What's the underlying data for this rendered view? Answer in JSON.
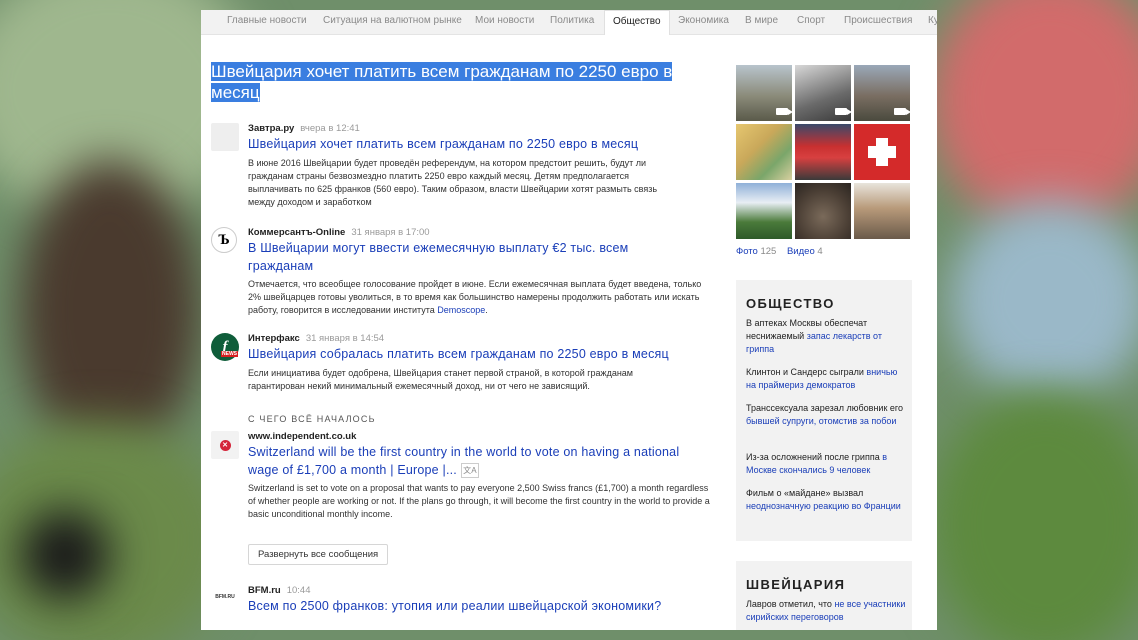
{
  "nav": {
    "items": [
      "Главные новости",
      "Ситуация на валютном рынке",
      "Мои новости",
      "Политика",
      "Общество",
      "Экономика",
      "В мире",
      "Спорт",
      "Происшествия",
      "Ку"
    ],
    "active": "Общество"
  },
  "headline": "Швейцария хочет платить всем гражданам по 2250 евро в месяц",
  "articles": [
    {
      "source": "Завтра.ру",
      "time": "вчера в 12:41",
      "title": "Швейцария хочет платить всем гражданам по 2250 евро в месяц",
      "snippet": "В июне 2016 Швейцарии будет проведён референдум, на котором предстоит решить, будут ли гражданам страны безвозмездно платить 2250 евро каждый месяц. Детям предполагается выплачивать по 625 франков (560 евро). Таким образом, власти Швейцарии хотят размыть связь между доходом и заработком"
    },
    {
      "source": "Коммерсантъ-Online",
      "time": "31 января в 17:00",
      "title": "В Швейцарии могут ввести ежемесячную выплату €2 тыс. всем гражданам",
      "snippet": "Отмечается, что всеобщее голосование пройдет в июне. Если ежемесячная выплата будет введена, только 2% швейцарцев готовы уволиться, в то время как большинство намерены продолжить работать или искать работу, говорится в исследовании института",
      "snippet_link": "Demoscope",
      "snippet_end": "."
    },
    {
      "source": "Интерфакс",
      "time": "31 января в 14:54",
      "title": "Швейцария собралась платить всем гражданам по 2250 евро в месяц",
      "snippet": "Если инициатива будет одобрена, Швейцария станет первой страной, в которой гражданам гарантирован некий минимальный ежемесячный доход, ни от чего не зависящий."
    },
    {
      "source": "www.independent.co.uk",
      "time": "",
      "title": "Switzerland will be the first country in the world to vote on having a national wage of £1,700 a month | Europe |...",
      "snippet": "Switzerland is set to vote on a proposal that wants to pay everyone 2,500 Swiss francs (£1,700) a month regardless of whether people are working or not. If the plans go through, it will become the first country in the world to provide a basic unconditional monthly income."
    },
    {
      "source": "BFM.ru",
      "time": "10:44",
      "title": "Всем по 2500 франков: утопия или реалии швейцарской экономики?",
      "snippet": ""
    }
  ],
  "section_label": "С ЧЕГО ВСЁ НАЧАЛОСЬ",
  "expand_label": "Развернуть все сообщения",
  "logos": {
    "kommersant": "Ъ",
    "interfax": "f",
    "interfax_sub": "NEWS",
    "bfm": "BFM.RU"
  },
  "media": {
    "photo_label": "Фото",
    "photo_count": "125",
    "video_label": "Видео",
    "video_count": "4"
  },
  "sidebar": {
    "society": {
      "title": "ОБЩЕСТВО",
      "entries": [
        {
          "text": "В аптеках Москвы обеспечат неснижаемый",
          "link": "запас лекарств от гриппа",
          "tail": ""
        },
        {
          "text": "Клинтон и Сандерс сыграли",
          "link": "вничью на праймериз демократов",
          "tail": ""
        },
        {
          "text": "Транссексуала зарезал любовник его",
          "link": "бывшей супруги, отомстив за побои",
          "tail": ""
        },
        {
          "text": "Из-за осложнений после гриппа",
          "link": "в Москве скончались 9 человек",
          "tail": ""
        },
        {
          "text": "Фильм о «майдане» вызвал",
          "link": "неоднозначную реакцию во Франции",
          "tail": ""
        }
      ]
    },
    "switzerland": {
      "title": "ШВЕЙЦАРИЯ",
      "entries": [
        {
          "text": "Лавров отметил, что",
          "link": "не все участники сирийских переговоров",
          "tail": ""
        }
      ]
    }
  },
  "colors": {
    "link": "#1a3eb8",
    "selection": "#3a7ee0",
    "sidebar_bg": "#f2f2f2"
  }
}
